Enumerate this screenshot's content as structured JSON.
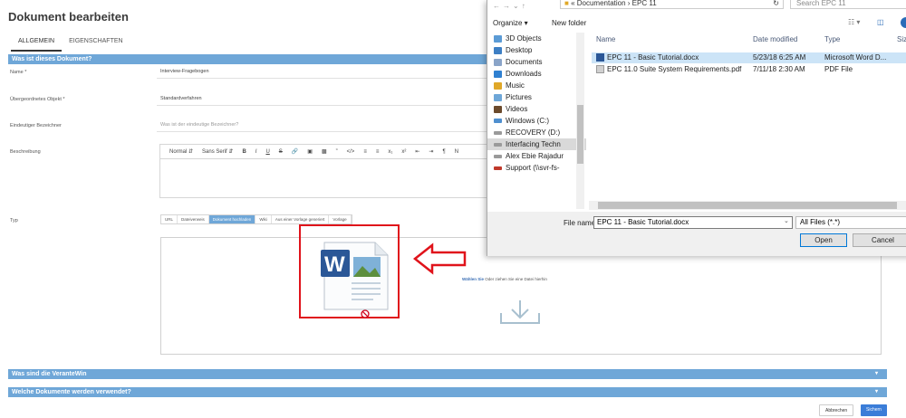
{
  "form": {
    "title": "Dokument bearbeiten",
    "tabs": [
      {
        "label": "ALLGEMEIN"
      },
      {
        "label": "EIGENSCHAFTEN"
      }
    ],
    "section1": "Was ist dieses Dokument?",
    "section2": "Was sind die VeranteWin",
    "section3": "Welche Dokumente werden verwendet?",
    "labels": {
      "name": "Name *",
      "parent": "Übergeordnetes Objekt *",
      "identifier": "Eindeutiger Bezeichner",
      "description": "Beschreibung",
      "type": "Typ"
    },
    "values": {
      "name": "Interview-Fragebogen",
      "parent": "Standardverfahren",
      "identifier_placeholder": "Was ist der eindeutige Bezeichner?"
    },
    "editor": {
      "format": "Normal",
      "font": "Sans Serif",
      "extra": "N"
    },
    "type_options": [
      "URL",
      "Dateiverweis",
      "Dokument hochladen",
      "Wiki",
      "Aus einer Vorlage generiert",
      "Vorlage"
    ],
    "drop_link": "Wählen Sie",
    "drop_text": "Oder ziehen Sie eine Datei hierhin",
    "cancel_label": "Abbrechen",
    "save_label": "Sichern"
  },
  "dialog": {
    "breadcrumb": "« Documentation › EPC 11",
    "search_placeholder": "Search EPC 11",
    "organize": "Organize ▾",
    "new_folder": "New folder",
    "nav_items": [
      {
        "label": "3D Objects",
        "color": "#5b9bd5"
      },
      {
        "label": "Desktop",
        "color": "#3d7fc4"
      },
      {
        "label": "Documents",
        "color": "#8aa4c8"
      },
      {
        "label": "Downloads",
        "color": "#2f80d1"
      },
      {
        "label": "Music",
        "color": "#e0a828"
      },
      {
        "label": "Pictures",
        "color": "#6ea7d8"
      },
      {
        "label": "Videos",
        "color": "#6b4a2c"
      },
      {
        "label": "Windows (C:)",
        "color": "#4f8fcf"
      },
      {
        "label": "RECOVERY (D:)",
        "color": "#9a9a9a"
      },
      {
        "label": "Interfacing Techn",
        "color": "#9a9a9a"
      },
      {
        "label": "Alex Ebie Rajadur",
        "color": "#9a9a9a"
      },
      {
        "label": "Support (\\\\svr-fs-",
        "color": "#c0392b"
      }
    ],
    "columns": {
      "name": "Name",
      "date": "Date modified",
      "type": "Type",
      "size": "Siz"
    },
    "files": [
      {
        "name": "EPC 11 - Basic Tutorial.docx",
        "date": "5/23/18 6:25 AM",
        "type": "Microsoft Word D..."
      },
      {
        "name": "EPC 11.0 Suite System Requirements.pdf",
        "date": "7/11/18 2:30 AM",
        "type": "PDF File"
      }
    ],
    "filename_label": "File name:",
    "filename_value": "EPC 11 - Basic Tutorial.docx",
    "filetype_value": "All Files (*.*)",
    "open_label": "Open",
    "cancel_label": "Cancel"
  }
}
